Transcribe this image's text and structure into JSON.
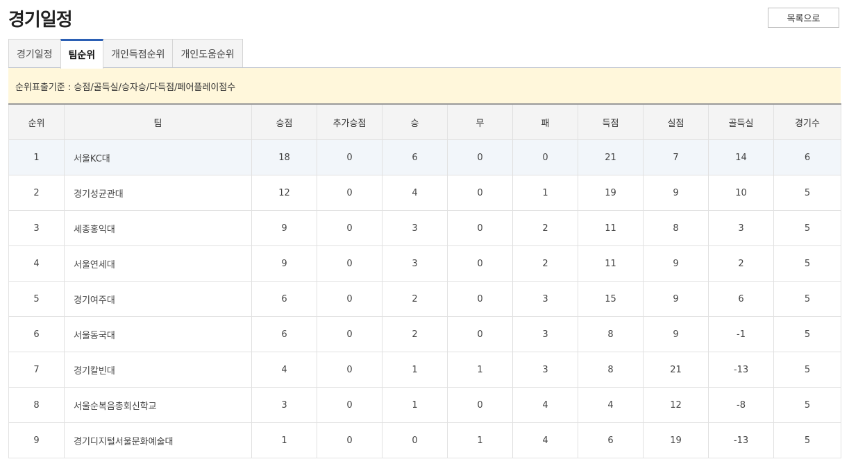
{
  "page": {
    "title": "경기일정",
    "list_button": "목록으로"
  },
  "tabs": [
    {
      "label": "경기일정",
      "active": false
    },
    {
      "label": "팀순위",
      "active": true
    },
    {
      "label": "개인득점순위",
      "active": false
    },
    {
      "label": "개인도움순위",
      "active": false
    }
  ],
  "notice": {
    "text": "순위표출기준 : 승점/골득실/승자승/다득점/페어플레이점수"
  },
  "colors": {
    "active_tab_accent": "#2b5fb4",
    "notice_background": "#fff7db",
    "header_background": "#f4f4f4"
  },
  "table": {
    "headers": [
      "순위",
      "팀",
      "승점",
      "추가승점",
      "승",
      "무",
      "패",
      "득점",
      "실점",
      "골득실",
      "경기수"
    ],
    "rows": [
      [
        "1",
        "서울KC대",
        "18",
        "0",
        "6",
        "0",
        "0",
        "21",
        "7",
        "14",
        "6"
      ],
      [
        "2",
        "경기성균관대",
        "12",
        "0",
        "4",
        "0",
        "1",
        "19",
        "9",
        "10",
        "5"
      ],
      [
        "3",
        "세종홍익대",
        "9",
        "0",
        "3",
        "0",
        "2",
        "11",
        "8",
        "3",
        "5"
      ],
      [
        "4",
        "서울연세대",
        "9",
        "0",
        "3",
        "0",
        "2",
        "11",
        "9",
        "2",
        "5"
      ],
      [
        "5",
        "경기여주대",
        "6",
        "0",
        "2",
        "0",
        "3",
        "15",
        "9",
        "6",
        "5"
      ],
      [
        "6",
        "서울동국대",
        "6",
        "0",
        "2",
        "0",
        "3",
        "8",
        "9",
        "-1",
        "5"
      ],
      [
        "7",
        "경기칼빈대",
        "4",
        "0",
        "1",
        "1",
        "3",
        "8",
        "21",
        "-13",
        "5"
      ],
      [
        "8",
        "서울순복음총회신학교",
        "3",
        "0",
        "1",
        "0",
        "4",
        "4",
        "12",
        "-8",
        "5"
      ],
      [
        "9",
        "경기디지털서울문화예술대",
        "1",
        "0",
        "0",
        "1",
        "4",
        "6",
        "19",
        "-13",
        "5"
      ]
    ]
  }
}
